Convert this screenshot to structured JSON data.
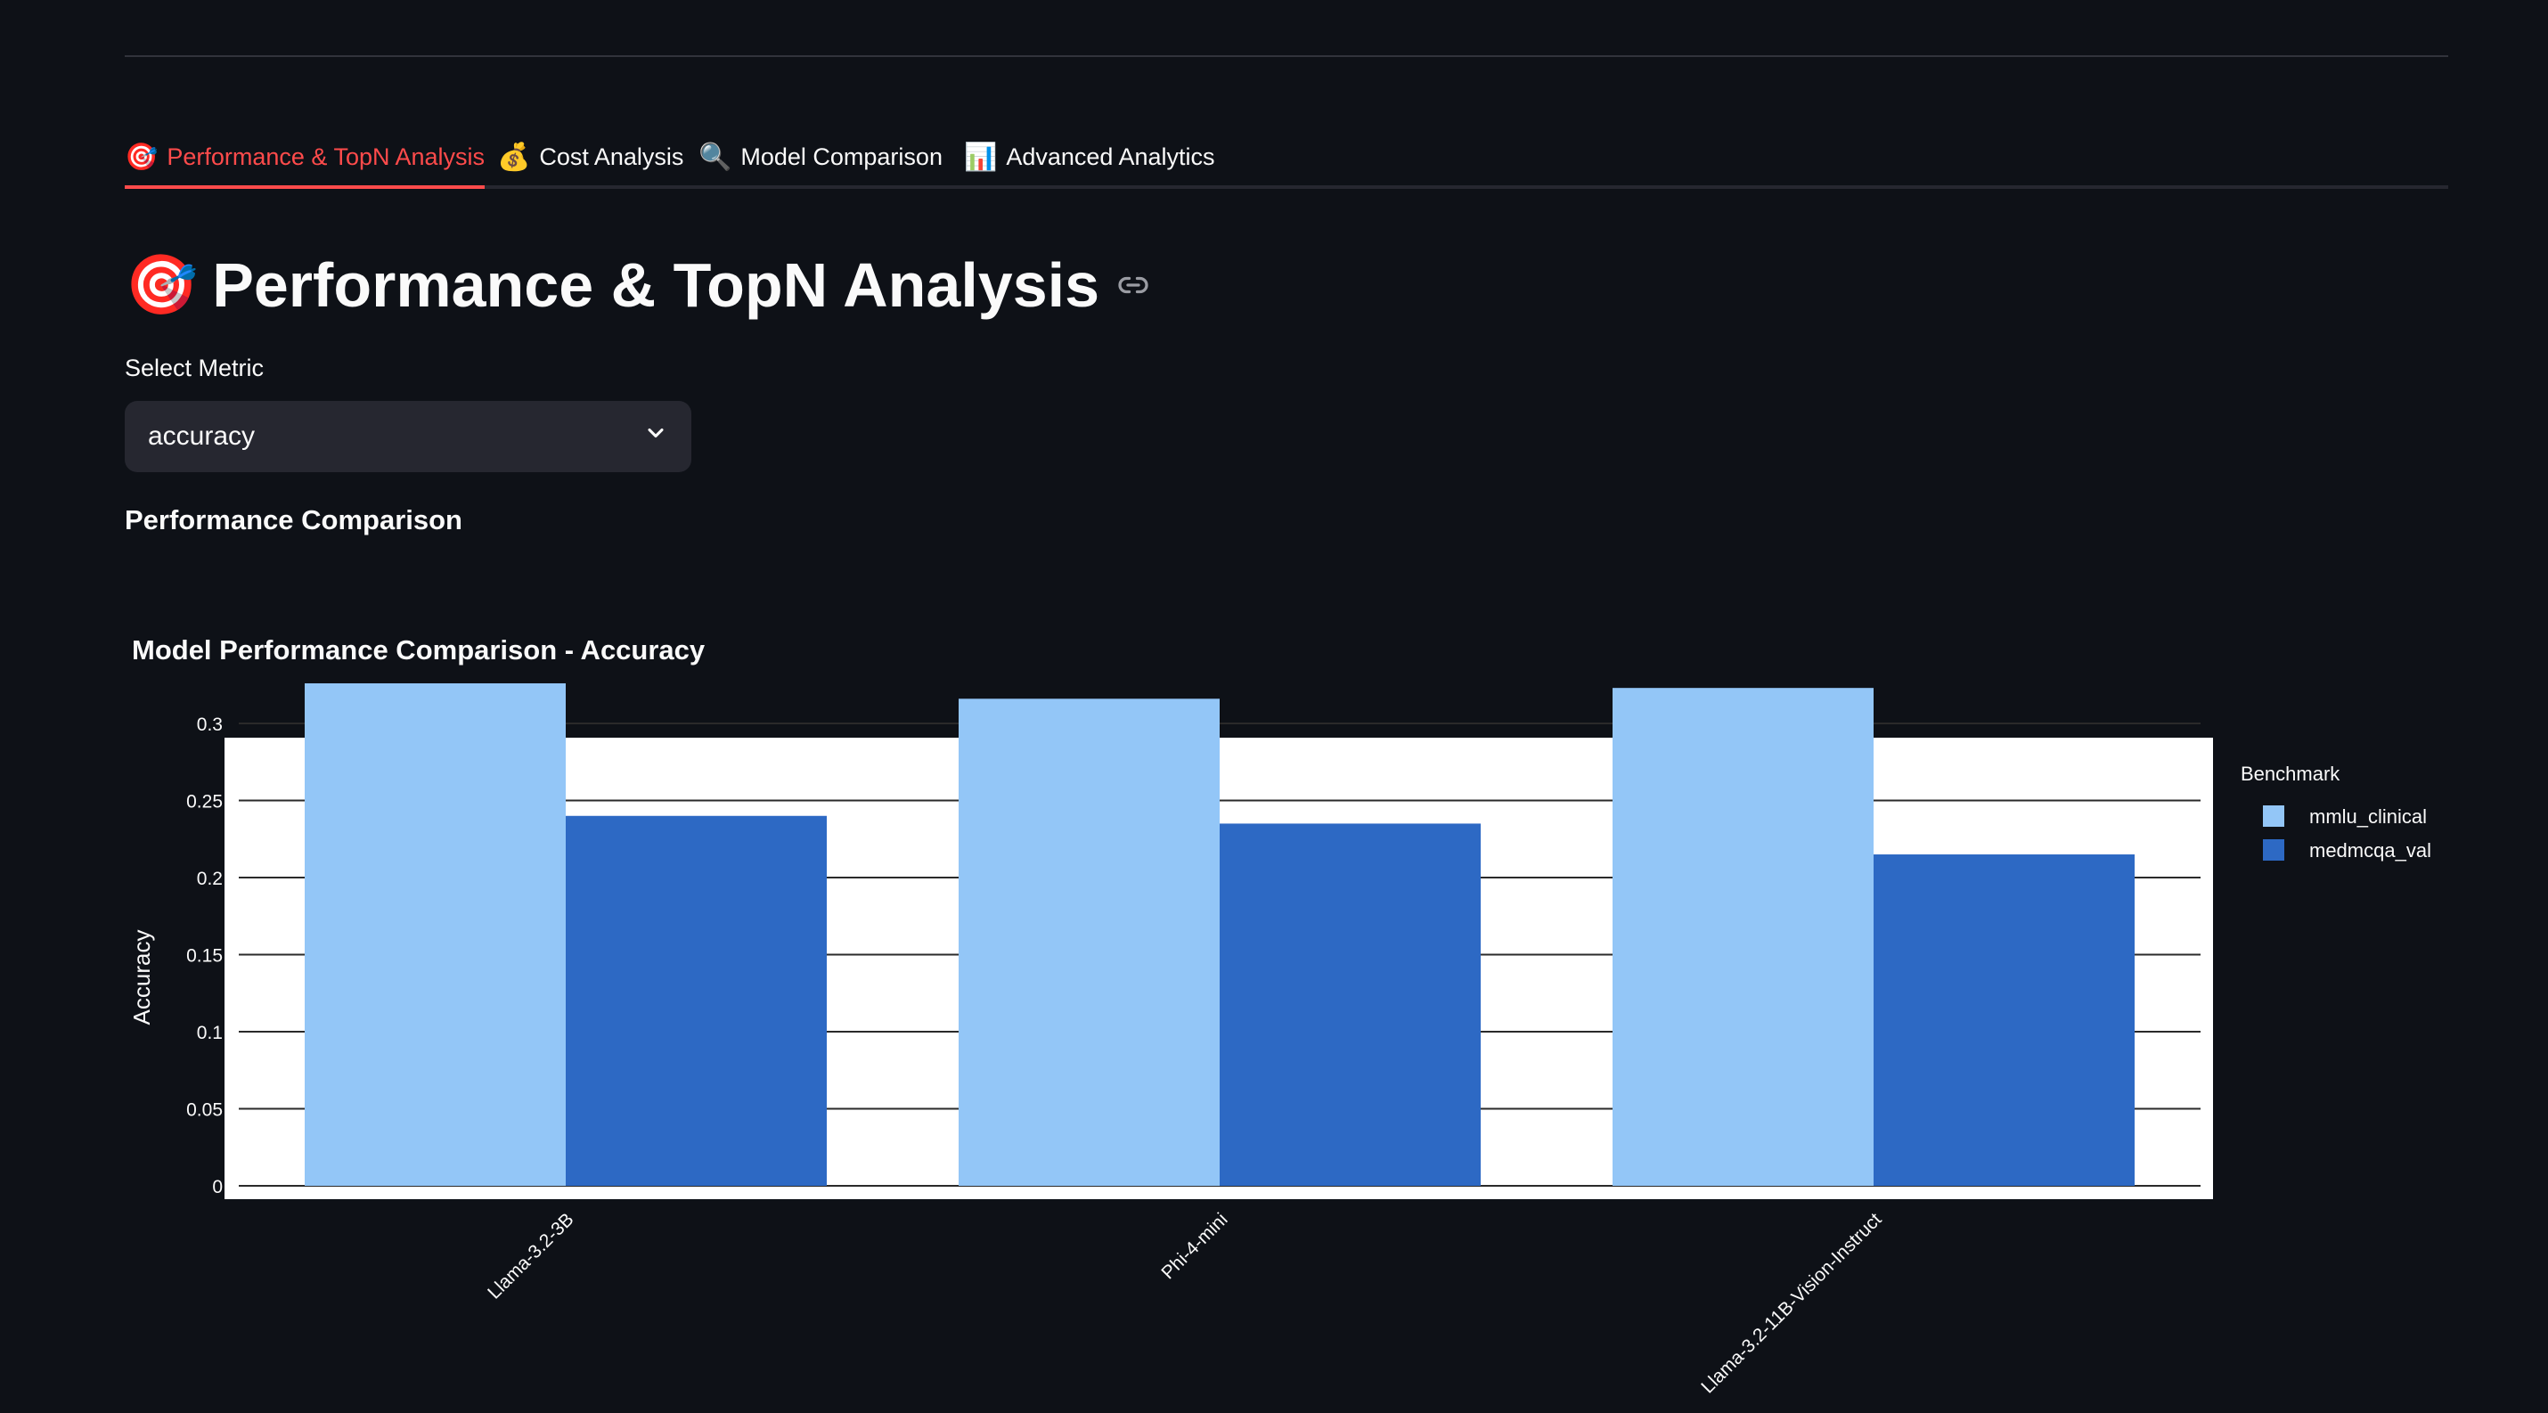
{
  "tabs": [
    {
      "icon": "🎯",
      "label": "Performance & TopN Analysis"
    },
    {
      "icon": "💰",
      "label": "Cost Analysis"
    },
    {
      "icon": "🔍",
      "label": "Model Comparison"
    },
    {
      "icon": "📊",
      "label": "Advanced Analytics"
    }
  ],
  "page": {
    "title_icon": "🎯",
    "title": "Performance & TopN Analysis",
    "select_label": "Select Metric",
    "select_value": "accuracy",
    "subheader": "Performance Comparison"
  },
  "colors": {
    "accent": "#ff4b4b",
    "background": "#0e1117",
    "mmlu_clinical": "#93c6f7",
    "medmcqa_val": "#2d69c4"
  },
  "chart_data": {
    "type": "bar",
    "title": "Model Performance Comparison - Accuracy",
    "categories": [
      "Llama-3.2-3B",
      "Phi-4-mini",
      "Llama-3.2-11B-Vision-Instruct"
    ],
    "series": [
      {
        "name": "mmlu_clinical",
        "values": [
          0.326,
          0.316,
          0.323
        ]
      },
      {
        "name": "medmcqa_val",
        "values": [
          0.24,
          0.235,
          0.215
        ]
      }
    ],
    "xlabel": "",
    "ylabel": "Accuracy",
    "ylim": [
      0,
      0.352
    ],
    "yticks": [
      0,
      0.05,
      0.1,
      0.15,
      0.2,
      0.25,
      0.3
    ],
    "legend_title": "Benchmark",
    "legend_position": "right",
    "grid": true
  }
}
